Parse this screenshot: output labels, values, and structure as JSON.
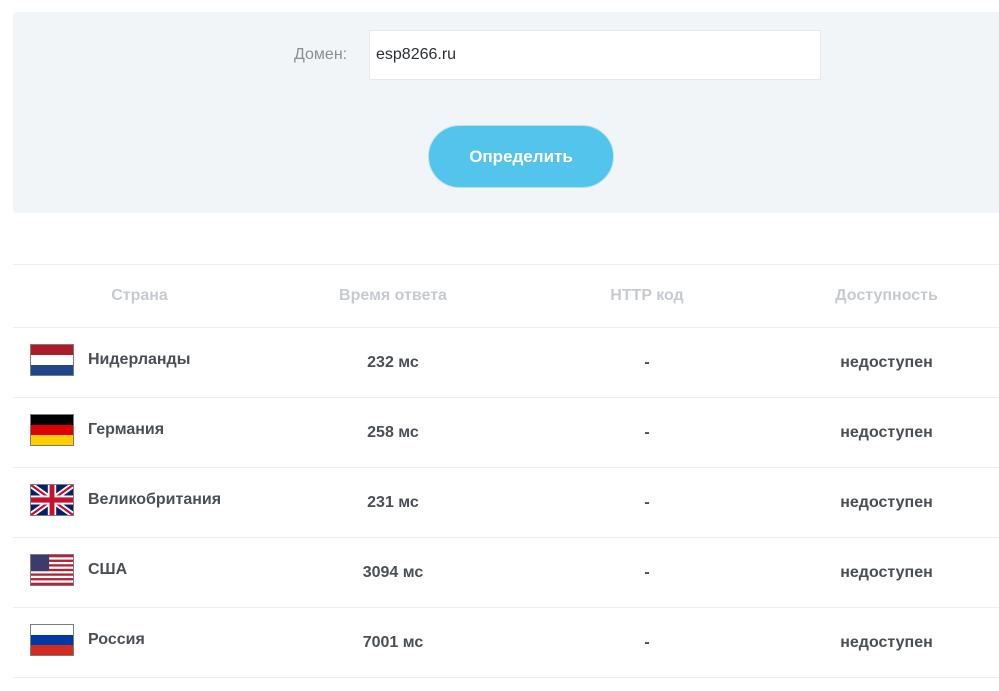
{
  "form": {
    "domain_label": "Домен:",
    "domain_value": "esp8266.ru",
    "submit_label": "Определить"
  },
  "table": {
    "headers": {
      "country": "Страна",
      "response_time": "Время ответа",
      "http_code": "HTTP код",
      "availability": "Доступность"
    },
    "rows": [
      {
        "flag_icon": "netherlands-flag-icon",
        "country": "Нидерланды",
        "time": "232 мс",
        "code": "-",
        "status": "недоступен"
      },
      {
        "flag_icon": "germany-flag-icon",
        "country": "Германия",
        "time": "258 мс",
        "code": "-",
        "status": "недоступен"
      },
      {
        "flag_icon": "uk-flag-icon",
        "country": "Великобритания",
        "time": "231 мс",
        "code": "-",
        "status": "недоступен"
      },
      {
        "flag_icon": "usa-flag-icon",
        "country": "США",
        "time": "3094 мс",
        "code": "-",
        "status": "недоступен"
      },
      {
        "flag_icon": "russia-flag-icon",
        "country": "Россия",
        "time": "7001 мс",
        "code": "-",
        "status": "недоступен"
      }
    ]
  },
  "colors": {
    "button": "#53c4ec",
    "status_unavailable": "#e2000a",
    "panel_background": "#f2f5f7"
  }
}
